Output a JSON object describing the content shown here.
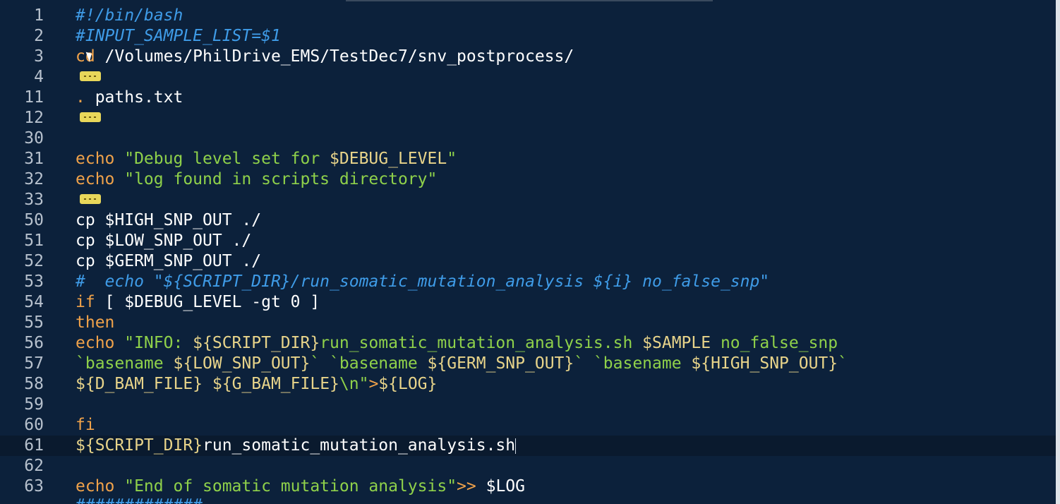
{
  "lines": [
    {
      "n": "1",
      "t": [
        {
          "c": "comment",
          "v": "#!/bin/bash"
        }
      ]
    },
    {
      "n": "2",
      "t": [
        {
          "c": "comment",
          "v": "#INPUT_SAMPLE_LIST=$1"
        }
      ]
    },
    {
      "n": "3",
      "t": [
        {
          "c": "kw",
          "v": "cd"
        },
        {
          "c": "plain",
          "v": " /Volumes/PhilDrive_EMS/TestDec7/snv_postprocess/"
        }
      ]
    },
    {
      "n": "4",
      "fold": true,
      "t": []
    },
    {
      "n": "11",
      "t": [
        {
          "c": "kw",
          "v": "."
        },
        {
          "c": "plain",
          "v": " paths.txt"
        }
      ]
    },
    {
      "n": "12",
      "fold": true,
      "t": []
    },
    {
      "n": "30",
      "t": []
    },
    {
      "n": "31",
      "t": [
        {
          "c": "kw",
          "v": "echo"
        },
        {
          "c": "str",
          "v": " \"Debug level set for "
        },
        {
          "c": "var",
          "v": "$DEBUG_LEVEL"
        },
        {
          "c": "str",
          "v": "\""
        }
      ]
    },
    {
      "n": "32",
      "t": [
        {
          "c": "kw",
          "v": "echo"
        },
        {
          "c": "str",
          "v": " \"log found in scripts directory\""
        }
      ]
    },
    {
      "n": "33",
      "fold": true,
      "t": []
    },
    {
      "n": "50",
      "t": [
        {
          "c": "plain",
          "v": "cp $HIGH_SNP_OUT ./"
        }
      ]
    },
    {
      "n": "51",
      "t": [
        {
          "c": "plain",
          "v": "cp $LOW_SNP_OUT ./"
        }
      ]
    },
    {
      "n": "52",
      "t": [
        {
          "c": "plain",
          "v": "cp $GERM_SNP_OUT ./"
        }
      ]
    },
    {
      "n": "53",
      "t": [
        {
          "c": "comment",
          "v": "#  echo \"${SCRIPT_DIR}/run_somatic_mutation_analysis ${i} no_false_snp\""
        }
      ]
    },
    {
      "n": "54",
      "t": [
        {
          "c": "kw",
          "v": "if"
        },
        {
          "c": "plain",
          "v": " [ $DEBUG_LEVEL -gt 0 ]"
        }
      ]
    },
    {
      "n": "55",
      "t": [
        {
          "c": "kw",
          "v": "then"
        }
      ]
    },
    {
      "n": "56",
      "t": [
        {
          "c": "kw",
          "v": "echo"
        },
        {
          "c": "str",
          "v": " \"INFO: "
        },
        {
          "c": "var",
          "v": "${SCRIPT_DIR}"
        },
        {
          "c": "str",
          "v": "run_somatic_mutation_analysis.sh "
        },
        {
          "c": "var",
          "v": "$SAMPLE"
        },
        {
          "c": "str",
          "v": " no_false_snp"
        }
      ]
    },
    {
      "n": "57",
      "t": [
        {
          "c": "str",
          "v": "`basename "
        },
        {
          "c": "var",
          "v": "${LOW_SNP_OUT}"
        },
        {
          "c": "str",
          "v": "` `basename "
        },
        {
          "c": "var",
          "v": "${GERM_SNP_OUT}"
        },
        {
          "c": "str",
          "v": "` `basename "
        },
        {
          "c": "var",
          "v": "${HIGH_SNP_OUT}"
        },
        {
          "c": "str",
          "v": "`"
        }
      ]
    },
    {
      "n": "58",
      "t": [
        {
          "c": "var",
          "v": "${D_BAM_FILE}"
        },
        {
          "c": "str",
          "v": " "
        },
        {
          "c": "var",
          "v": "${G_BAM_FILE}"
        },
        {
          "c": "str",
          "v": "\\n\""
        },
        {
          "c": "kw",
          "v": ">"
        },
        {
          "c": "var",
          "v": "${LOG}"
        }
      ]
    },
    {
      "n": "59",
      "t": []
    },
    {
      "n": "60",
      "t": [
        {
          "c": "kw",
          "v": "fi"
        }
      ]
    },
    {
      "n": "61",
      "current": true,
      "t": [
        {
          "c": "var",
          "v": "${SCRIPT_DIR}"
        },
        {
          "c": "plain",
          "v": "run_somatic_mutation_analysis.sh"
        }
      ]
    },
    {
      "n": "62",
      "t": []
    },
    {
      "n": "63",
      "t": [
        {
          "c": "kw",
          "v": "echo"
        },
        {
          "c": "str",
          "v": " \"End of somatic mutation analysis\""
        },
        {
          "c": "kw",
          "v": ">>"
        },
        {
          "c": "plain",
          "v": " $LOG"
        }
      ]
    }
  ],
  "cut_line": "#############",
  "colors": {
    "background": "#0c213b",
    "comment": "#3f9ce8",
    "keyword": "#f0a24a",
    "string": "#8fd14a",
    "variable": "#e8d48a",
    "fold_marker": "#e8d75a"
  }
}
